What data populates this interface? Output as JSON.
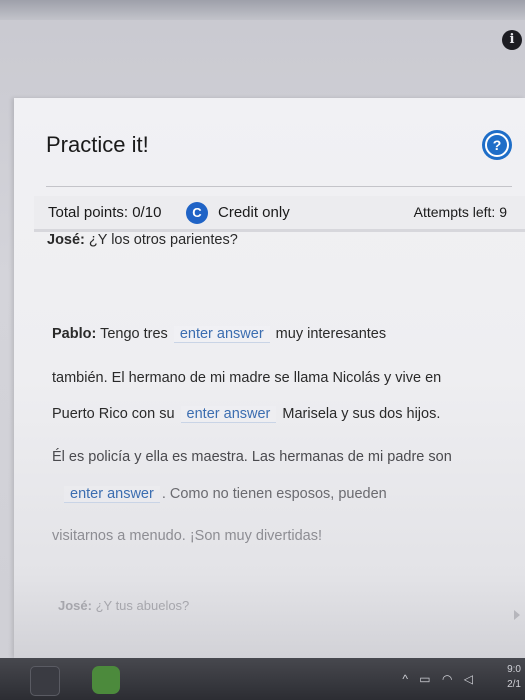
{
  "panel": {
    "title": "Practice it!"
  },
  "score": {
    "total_points": "Total points: 0/10",
    "credit_badge": "C",
    "credit_text": "Credit only",
    "attempts": "Attempts left: 9"
  },
  "dialogue": {
    "line1_speaker": "José:",
    "line1_text": " ¿Y los otros parientes?",
    "line2_speaker": "Pablo:",
    "line2_text_a": " Tengo tres",
    "line2_text_b": " muy interesantes",
    "line3_text": "también. El hermano de mi madre se llama Nicolás y vive en",
    "line4_text_a": "Puerto Rico con su",
    "line4_text_b": " Marisela y sus dos hijos.",
    "line5_text": "Él es policía y ella es maestra. Las hermanas de mi padre son",
    "line6_text_b": ". Como no tienen esposos, pueden",
    "line7_text": "visitarnos a menudo. ¡Son muy divertidas!",
    "line8_speaker": "José:",
    "line8_text": " ¿Y tus abuelos?"
  },
  "answer_placeholder": "enter answer",
  "taskbar": {
    "clock_time": "9:0",
    "clock_date": "2/1"
  },
  "icons": {
    "info": "info-icon",
    "help": "help-icon",
    "credit": "credit-badge"
  }
}
